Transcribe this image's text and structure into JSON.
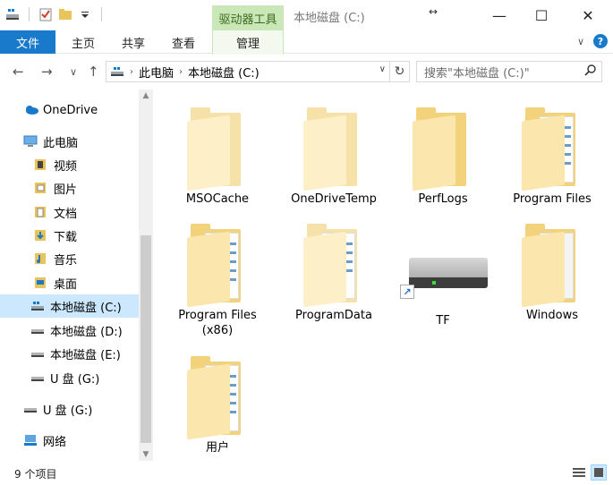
{
  "titlebar": {
    "title": "本地磁盘 (C:)",
    "context_tab": "驱动器工具",
    "minimize": "—",
    "maximize": "☐",
    "close": "✕"
  },
  "ribbon": {
    "tabs": [
      {
        "label": "文件"
      },
      {
        "label": "主页"
      },
      {
        "label": "共享"
      },
      {
        "label": "查看"
      },
      {
        "label": "管理"
      }
    ],
    "collapse": "∨",
    "help": "?"
  },
  "navigation": {
    "back": "←",
    "forward": "→",
    "recent": "∨",
    "up": "↑",
    "breadcrumb": [
      "此电脑",
      "本地磁盘 (C:)"
    ],
    "search_placeholder": "搜索\"本地磁盘 (C:)\""
  },
  "nav_pane": {
    "items": [
      {
        "label": "OneDrive",
        "icon": "cloud-icon"
      },
      {
        "label": "此电脑",
        "icon": "computer-icon"
      },
      {
        "label": "视频",
        "icon": "video-folder-icon"
      },
      {
        "label": "图片",
        "icon": "picture-folder-icon"
      },
      {
        "label": "文档",
        "icon": "document-folder-icon"
      },
      {
        "label": "下载",
        "icon": "download-folder-icon"
      },
      {
        "label": "音乐",
        "icon": "music-folder-icon"
      },
      {
        "label": "桌面",
        "icon": "desktop-folder-icon"
      },
      {
        "label": "本地磁盘 (C:)",
        "icon": "system-drive-icon",
        "selected": true
      },
      {
        "label": "本地磁盘 (D:)",
        "icon": "drive-icon"
      },
      {
        "label": "本地磁盘 (E:)",
        "icon": "drive-icon"
      },
      {
        "label": "U 盘 (G:)",
        "icon": "usb-drive-icon"
      },
      {
        "label": "U 盘 (G:)",
        "icon": "usb-drive-icon"
      },
      {
        "label": "网络",
        "icon": "network-icon"
      }
    ]
  },
  "content": {
    "items": [
      {
        "label": "MSOCache",
        "type": "folder-pale"
      },
      {
        "label": "OneDriveTemp",
        "type": "folder-pale"
      },
      {
        "label": "PerfLogs",
        "type": "folder"
      },
      {
        "label": "Program Files",
        "type": "folder-docs"
      },
      {
        "label": "Program Files\n(x86)",
        "label_line1": "Program Files",
        "label_line2": "(x86)",
        "type": "folder-docs"
      },
      {
        "label": "ProgramData",
        "type": "folder-pale-docs"
      },
      {
        "label": "TF",
        "type": "drive-shortcut"
      },
      {
        "label": "Windows",
        "type": "folder-windows"
      },
      {
        "label": "用户",
        "type": "folder-docs"
      }
    ]
  },
  "status": {
    "item_count": "9 个项目"
  }
}
